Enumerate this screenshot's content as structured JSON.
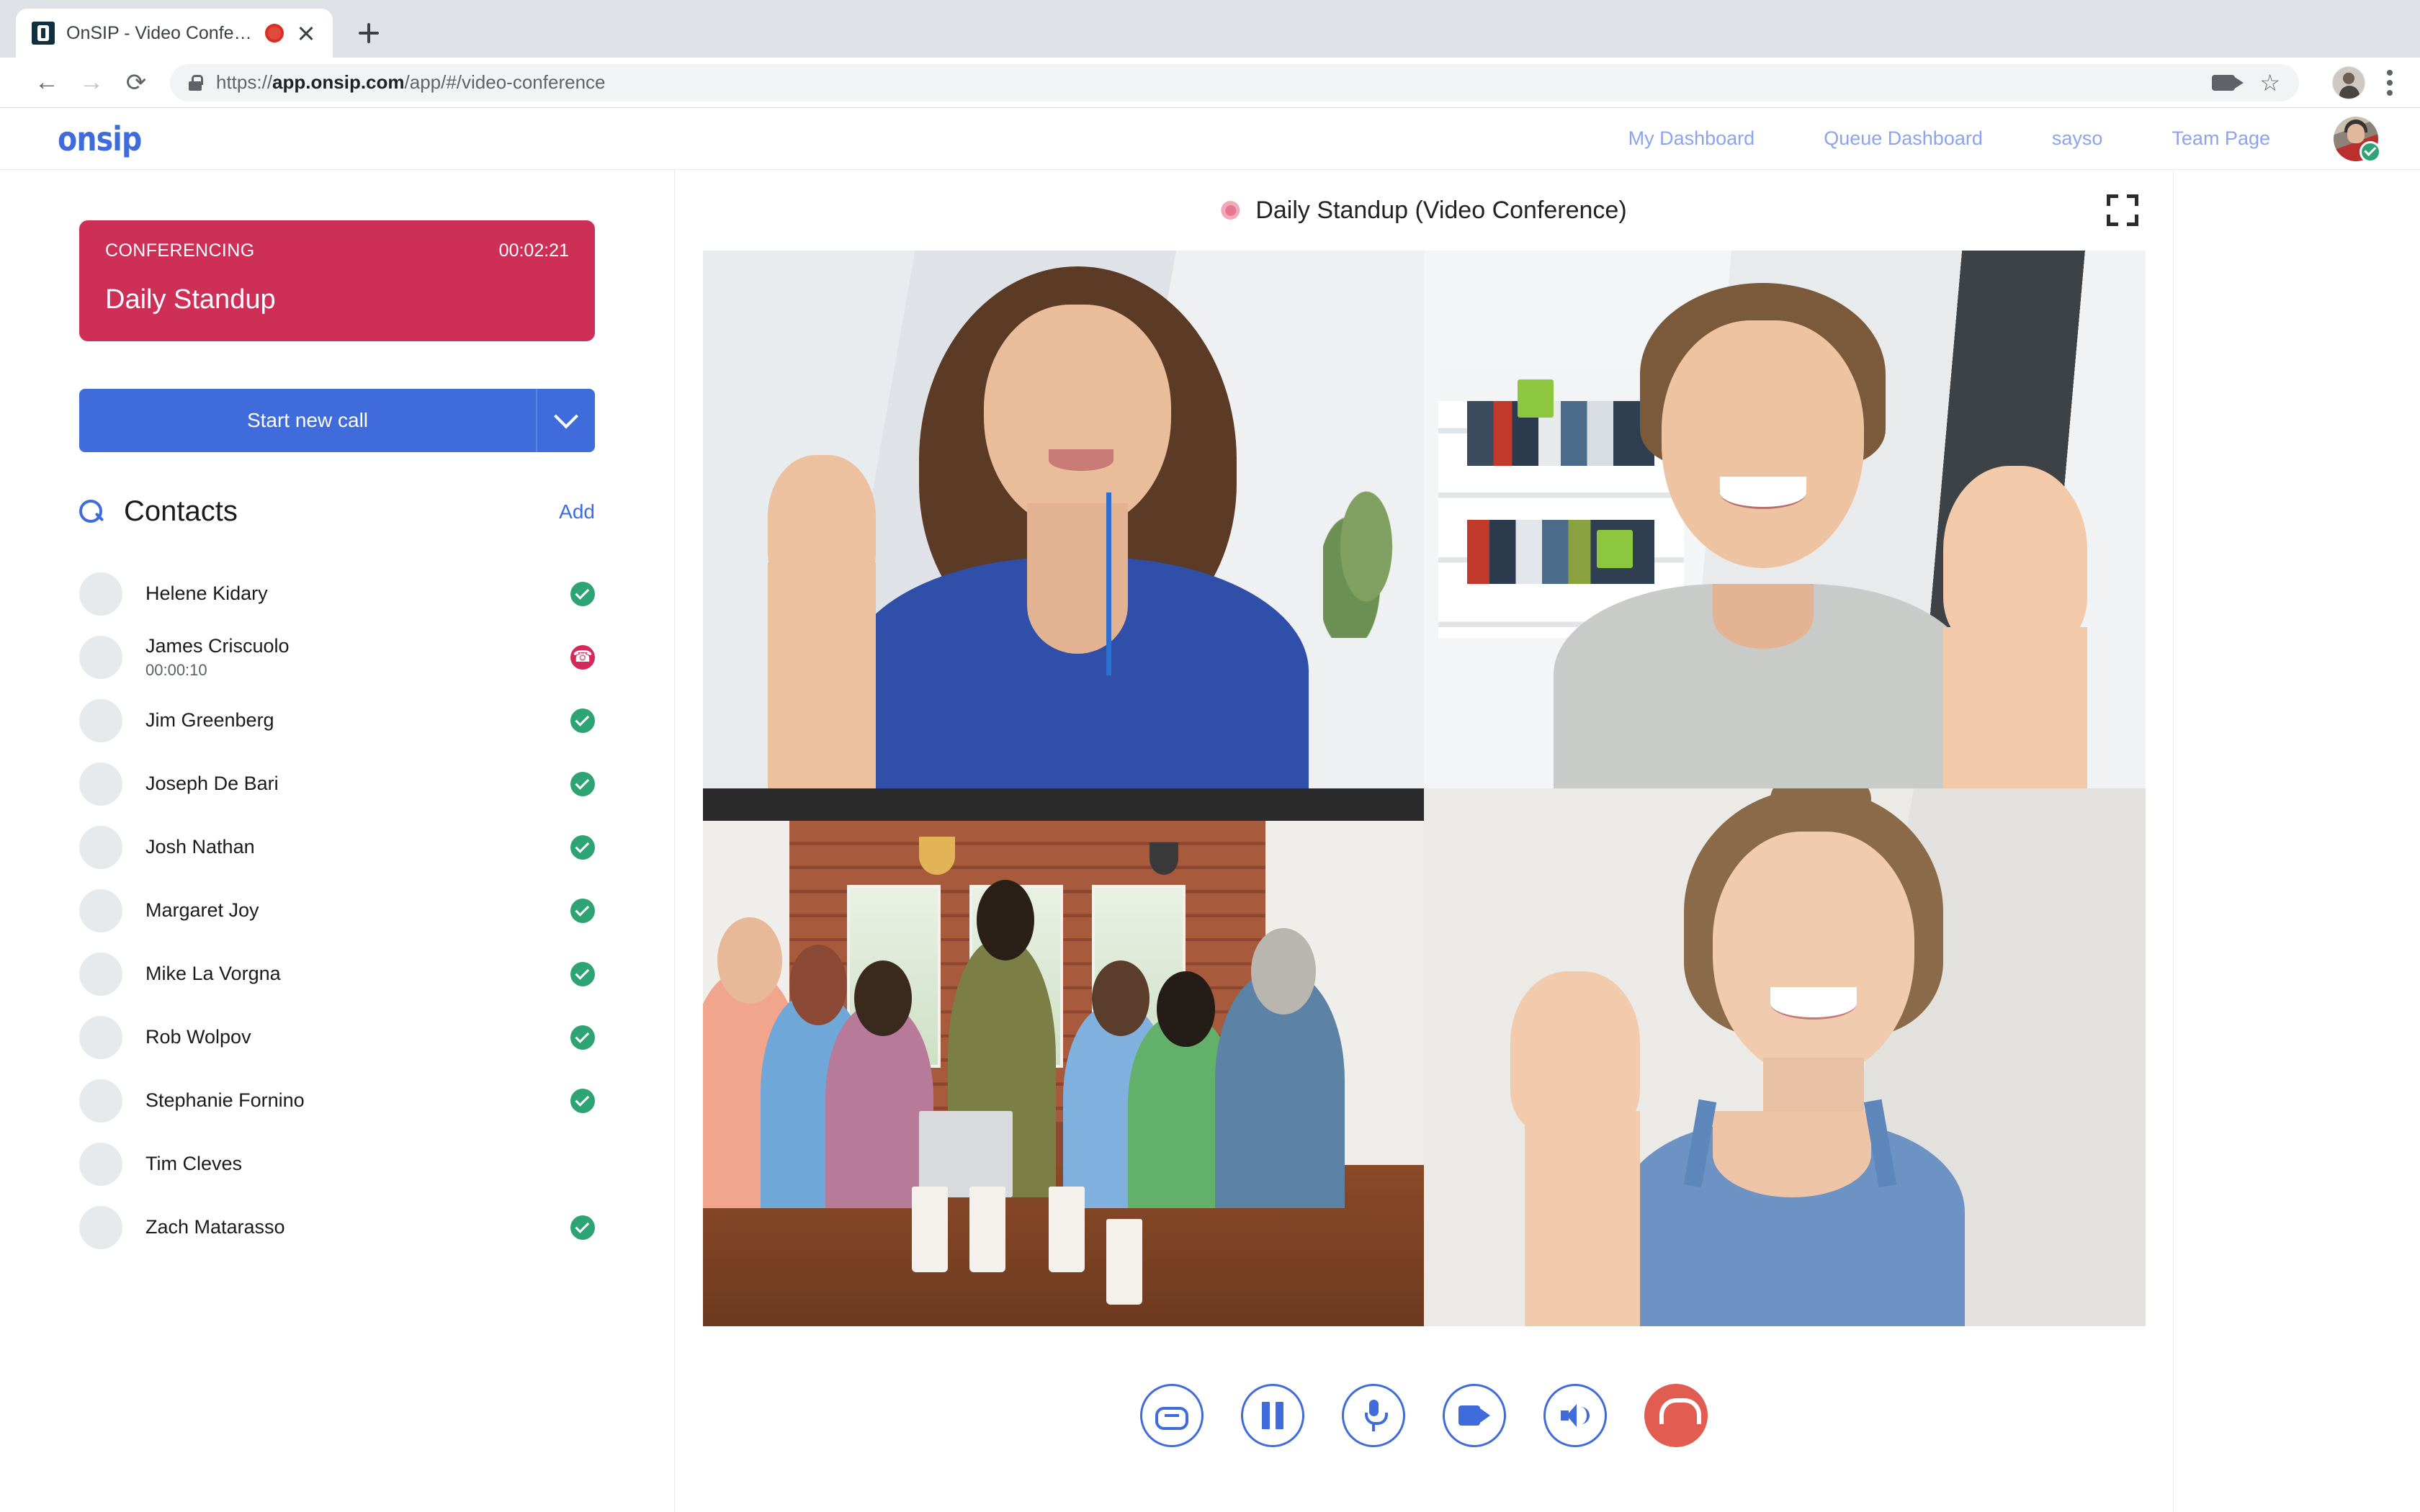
{
  "browser": {
    "tab": {
      "title": "OnSIP - Video Conference",
      "favicon": "onsip-favicon",
      "recording_indicator": "record-dot"
    },
    "new_tab_label": "+",
    "url_scheme": "https://",
    "url_host": "app.onsip.com",
    "url_path": "/app/#/video-conference",
    "toolbar_icons": [
      "back-arrow",
      "forward-arrow",
      "reload",
      "lock-icon",
      "camera-icon",
      "star-icon",
      "profile-avatar",
      "kebab-menu"
    ]
  },
  "app": {
    "logo": "onsip",
    "nav": [
      {
        "label": "My Dashboard"
      },
      {
        "label": "Queue Dashboard"
      },
      {
        "label": "sayso"
      },
      {
        "label": "Team Page"
      }
    ],
    "user_status": "online"
  },
  "sidebar": {
    "conference_card": {
      "status_label": "CONFERENCING",
      "timer": "00:02:21",
      "title": "Daily Standup",
      "color": "#ce2f57"
    },
    "start_call_button": "Start new call",
    "contacts": {
      "title": "Contacts",
      "add_label": "Add",
      "items": [
        {
          "name": "Helene Kidary",
          "status": "online",
          "avatar": "av-f1",
          "sub": ""
        },
        {
          "name": "James Criscuolo",
          "status": "oncall",
          "avatar": "av-f2",
          "sub": "00:00:10"
        },
        {
          "name": "Jim Greenberg",
          "status": "online",
          "avatar": "av-f3",
          "sub": ""
        },
        {
          "name": "Joseph De Bari",
          "status": "online",
          "avatar": "av-a1",
          "sub": ""
        },
        {
          "name": "Josh Nathan",
          "status": "online",
          "avatar": "av-a2",
          "sub": ""
        },
        {
          "name": "Margaret Joy",
          "status": "online",
          "avatar": "av-a3",
          "sub": ""
        },
        {
          "name": "Mike La Vorgna",
          "status": "online",
          "avatar": "av-f4",
          "sub": ""
        },
        {
          "name": "Rob Wolpov",
          "status": "online",
          "avatar": "av-f5",
          "sub": ""
        },
        {
          "name": "Stephanie Fornino",
          "status": "online",
          "avatar": "av-f6",
          "sub": ""
        },
        {
          "name": "Tim Cleves",
          "status": "none",
          "avatar": "av-f7",
          "sub": ""
        },
        {
          "name": "Zach Matarasso",
          "status": "online",
          "avatar": "av-floral",
          "sub": ""
        }
      ]
    }
  },
  "video_conference": {
    "title": "Daily Standup (Video Conference)",
    "recording_dot": "record-indicator",
    "expand_icon": "fullscreen-icon",
    "participants": [
      {
        "id": "tile-1",
        "description": "woman-in-blue-top-waving"
      },
      {
        "id": "tile-2",
        "description": "man-in-grey-polo-waving"
      },
      {
        "id": "tile-3",
        "description": "group-in-conference-room"
      },
      {
        "id": "tile-4",
        "description": "woman-in-blue-camisole-waving"
      }
    ],
    "controls": [
      {
        "name": "link-button",
        "icon": "link-icon"
      },
      {
        "name": "pause-button",
        "icon": "pause-icon"
      },
      {
        "name": "mic-button",
        "icon": "microphone-icon"
      },
      {
        "name": "video-button",
        "icon": "video-camera-icon"
      },
      {
        "name": "speaker-button",
        "icon": "speaker-icon"
      },
      {
        "name": "hangup-button",
        "icon": "hangup-icon"
      }
    ],
    "hangup_color": "#e15c51",
    "accent_color": "#3f6bdb"
  }
}
